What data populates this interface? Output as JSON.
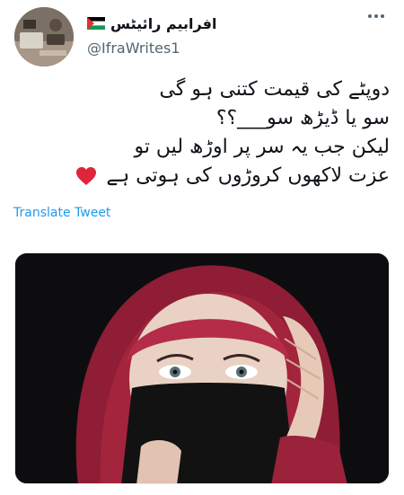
{
  "author": {
    "display_name": "افرابیم رائیٹس",
    "handle": "@IfraWrites1",
    "flag_icon": "palestine-flag-icon",
    "avatar_icon": "profile-photo"
  },
  "tweet": {
    "lines": [
      "دوپٹے کی قیمت کتنی ہو گی",
      "سو یا ڈیڑھ سو___؟؟",
      "لیکن جب یہ سر پر اوڑھ لیں تو",
      "عزت لاکھوں کروڑوں کی ہوتی ہے"
    ],
    "emoji": "red-heart-icon",
    "translate_label": "Translate Tweet"
  },
  "media": {
    "alt_icon": "photo-woman-in-hijab-with-niqab"
  },
  "colors": {
    "link": "#1d9bf0",
    "secondary_text": "#536471",
    "heart": "#e0243a",
    "hijab": "#a3243d"
  }
}
